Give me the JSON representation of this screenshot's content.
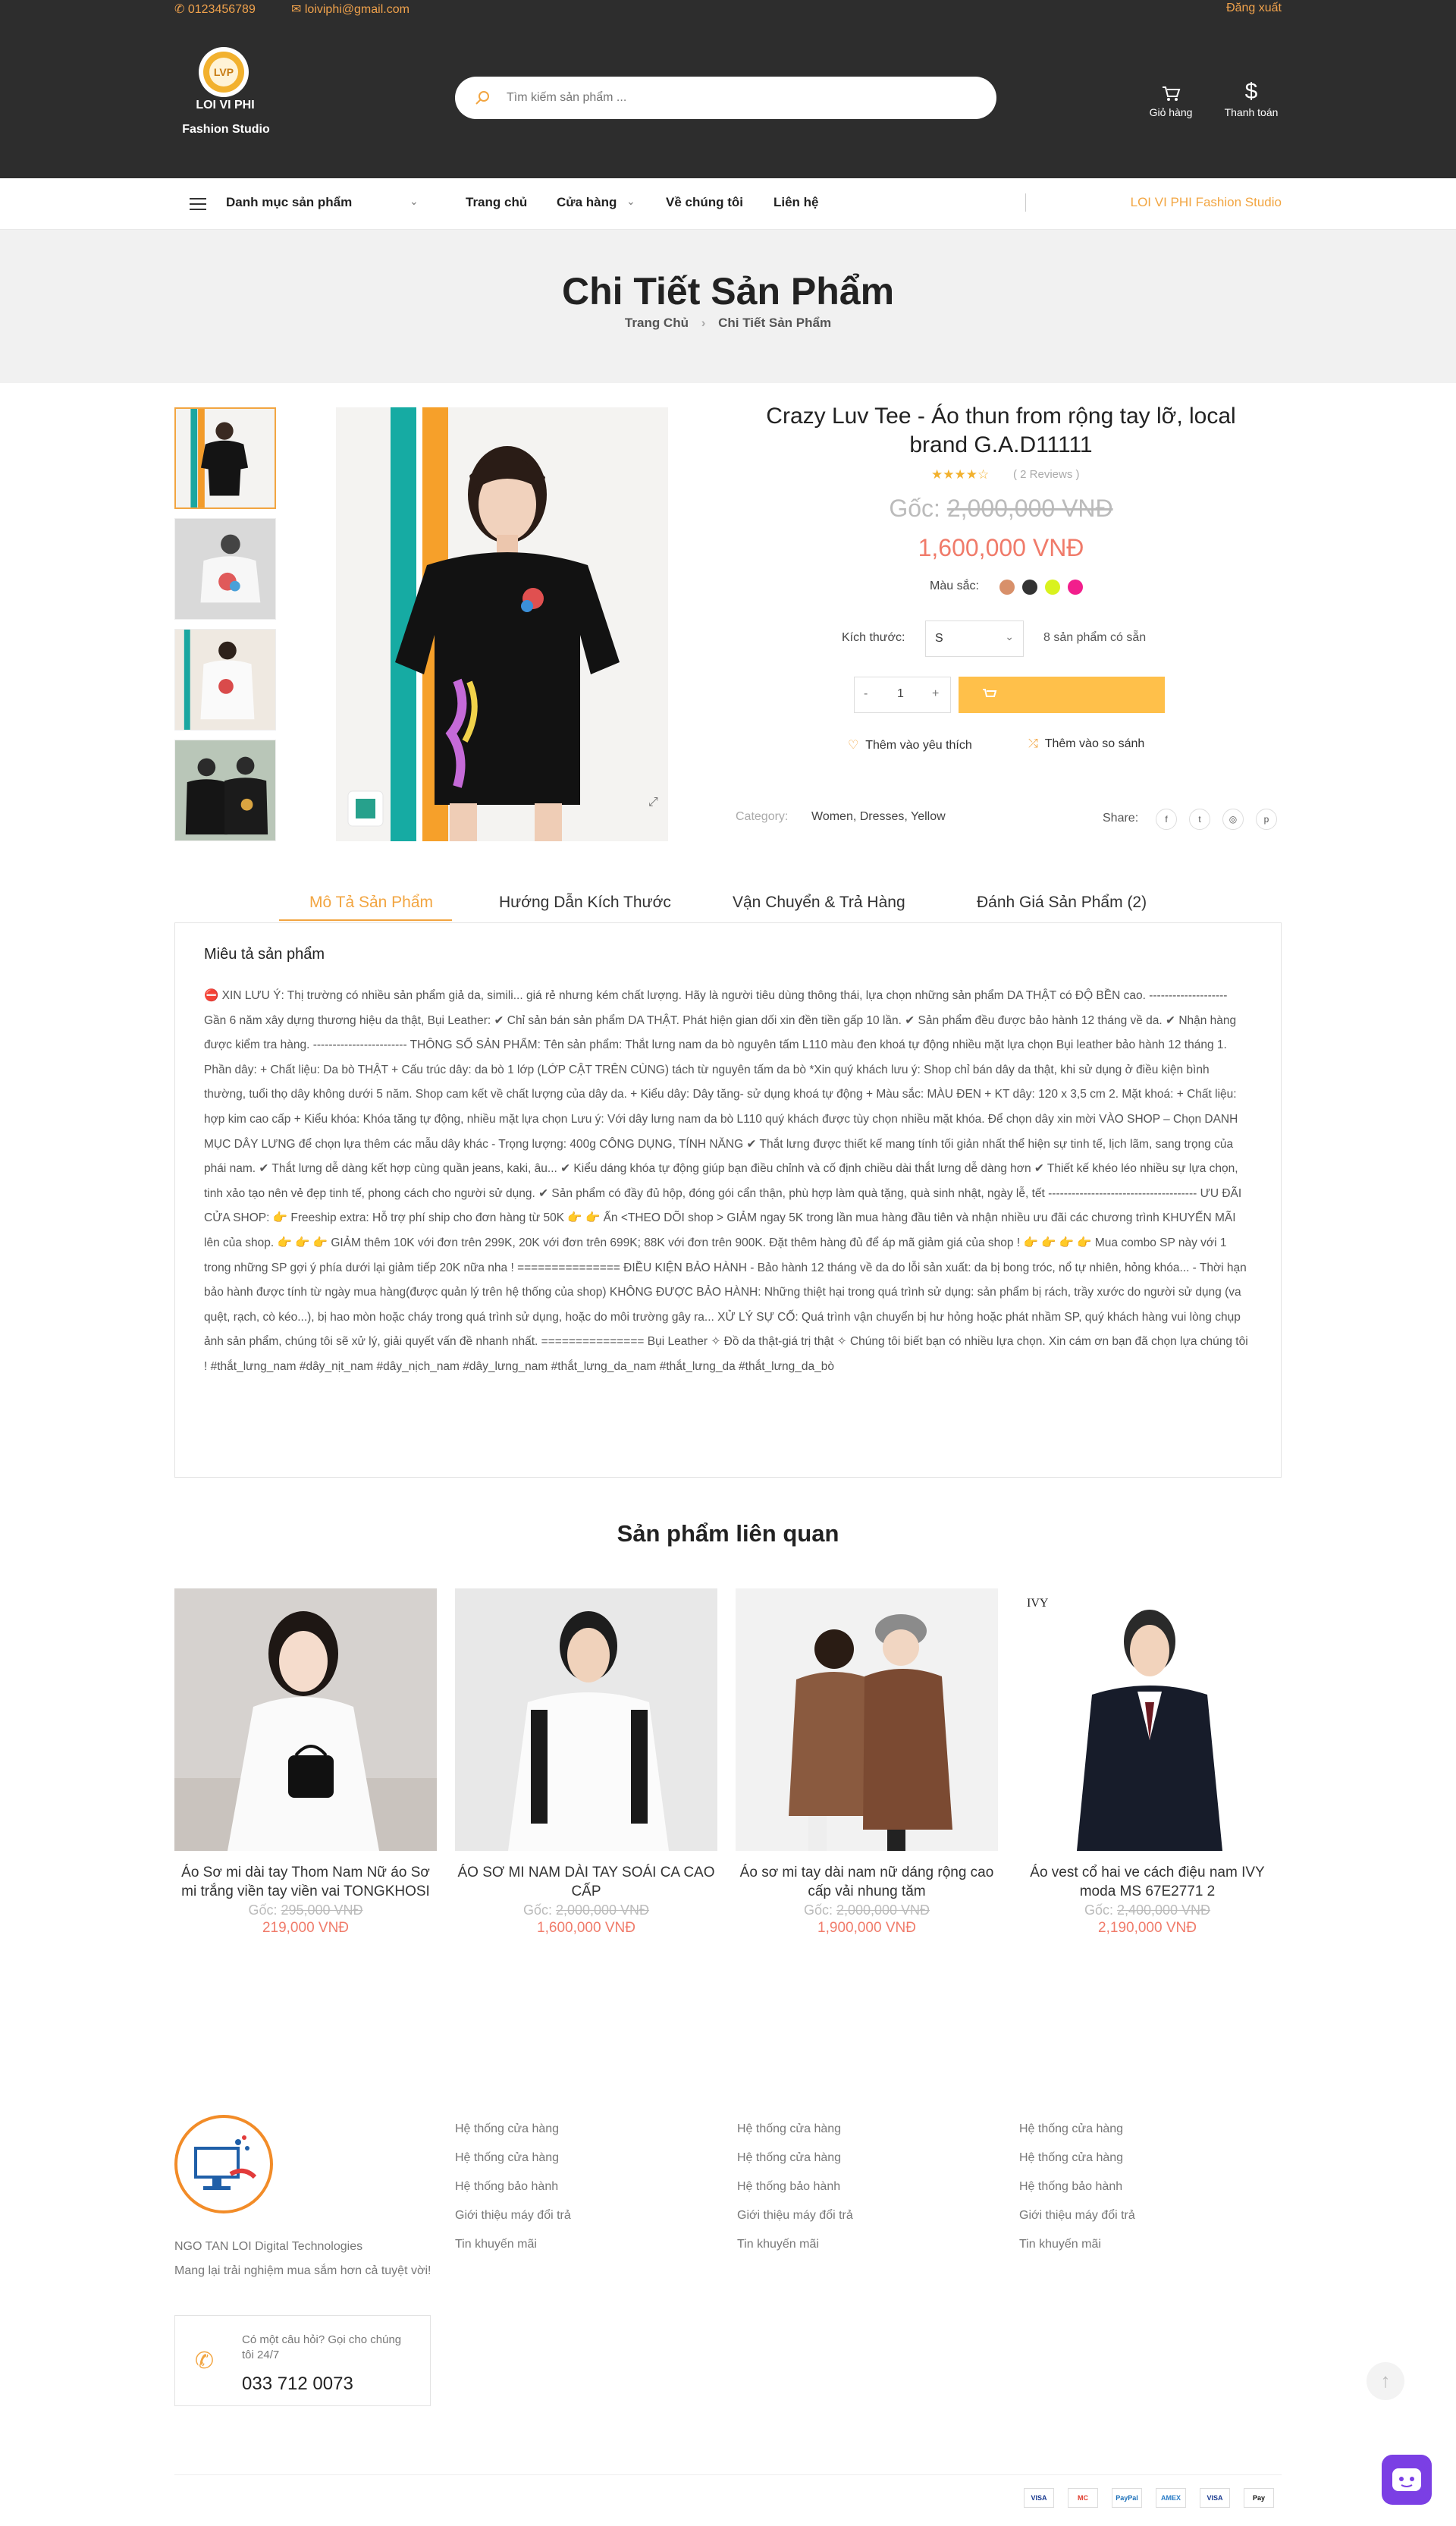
{
  "topbar": {
    "phone": "0123456789",
    "email": "loiviphi@gmail.com",
    "logout": "Đăng xuất"
  },
  "brand": {
    "line1": "LOI VI PHI",
    "line2": "Fashion Studio",
    "logo_mark": "LVP"
  },
  "search": {
    "placeholder": "Tìm kiếm sản phẩm ..."
  },
  "header_actions": {
    "cart": "Giỏ hàng",
    "checkout": "Thanh toán"
  },
  "nav": {
    "categories": "Danh mục sản phẩm",
    "home": "Trang chủ",
    "shop": "Cửa hàng",
    "about": "Về chúng tôi",
    "contact": "Liên hệ",
    "right_brand": "LOI VI PHI Fashion Studio"
  },
  "hero": {
    "title": "Chi Tiết Sản Phẩm",
    "crumb_home": "Trang Chủ",
    "crumb_sep": "›",
    "crumb_current": "Chi Tiết Sản Phẩm"
  },
  "product": {
    "title": "Crazy Luv Tee - Áo thun from rộng tay lỡ, local brand G.A.D11111",
    "stars": "★★★★☆",
    "reviews": "( 2 Reviews )",
    "old_label": "Gốc:",
    "old_price": "2,000,000 VNĐ",
    "price": "1,600,000 VNĐ",
    "color_label": "Màu sắc:",
    "colors": [
      "#d8906a",
      "#333333",
      "#d9f21e",
      "#f21e8c"
    ],
    "size_label": "Kích thước:",
    "size_value": "S",
    "stock": "8 sản phẩm có sẵn",
    "qty_minus": "-",
    "qty": "1",
    "qty_plus": "+",
    "wishlist": "Thêm vào yêu thích",
    "compare": "Thêm vào so sánh",
    "category_label": "Category:",
    "categories": "Women, Dresses, Yellow",
    "share_label": "Share:",
    "share_icons": [
      "f",
      "t",
      "◎",
      "p"
    ]
  },
  "tabs": [
    "Mô Tả Sản Phẩm",
    "Hướng Dẫn Kích Thước",
    "Vận Chuyển & Trả Hàng",
    "Đánh Giá Sản Phẩm (2)"
  ],
  "description": {
    "title": "Miêu tả sản phẩm",
    "text": "⛔ XIN LƯU Ý: Thị trường có nhiều sản phẩm giả da, simili... giá rẻ nhưng kém chất lượng. Hãy là người tiêu dùng thông thái, lựa chọn những sản phẩm DA THẬT có ĐỘ BỀN cao. -------------------- Gần 6 năm xây dựng thương hiệu da thật, Bụi Leather: ✔ Chỉ sản bán sản phẩm DA THẬT. Phát hiện gian dối xin đền tiền gấp 10 lần. ✔ Sản phẩm đều được bảo hành 12 tháng về da. ✔ Nhận hàng được kiểm tra hàng. ------------------------ THÔNG SỐ SẢN PHẨM: Tên sản phẩm: Thắt lưng nam da bò nguyên tấm L110 màu đen khoá tự động nhiều mặt lựa chọn Bụi leather bảo hành 12 tháng 1. Phần dây: + Chất liệu: Da bò THẬT + Cấu trúc dây: da bò 1 lớp (LỚP CẬT TRÊN CÙNG) tách từ nguyên tấm da bò *Xin quý khách lưu ý: Shop chỉ bán dây da thật, khi sử dụng ở điều kiện bình thường, tuổi thọ dây không dưới 5 năm. Shop cam kết về chất lượng của dây da. + Kiểu dây: Dây tăng- sử dụng khoá tự động + Màu sắc: MÀU ĐEN + KT dây: 120 x 3,5 cm 2. Mặt khoá: + Chất liệu: hợp kim cao cấp + Kiểu khóa: Khóa tăng tự động, nhiều mặt lựa chọn Lưu ý: Với dây lưng nam da bò L110 quý khách được tùy chọn nhiều mặt khóa. Để chọn dây xin mời VÀO SHOP – Chọn DANH MỤC DÂY LƯNG để chọn lựa thêm các mẫu dây khác - Trọng lượng: 400g CÔNG DỤNG, TÍNH NĂNG ✔ Thắt lưng được thiết kế mang tính tối giản nhất thể hiện sự tinh tế, lịch lãm, sang trọng của phái nam. ✔ Thắt lưng dễ dàng kết hợp cùng quần jeans, kaki, âu... ✔ Kiểu dáng khóa tự động giúp bạn điều chỉnh và cố định chiều dài thắt lưng dễ dàng hơn ✔ Thiết kế khéo léo nhiều sự lựa chọn, tinh xảo tạo nên vẻ đẹp tinh tế, phong cách cho người sử dụng. ✔ Sản phẩm có đầy đủ hộp, đóng gói cẩn thận, phù hợp làm quà tặng, quà sinh nhật, ngày lễ, tết -------------------------------------- ƯU ĐÃI CỬA SHOP: 👉 Freeship extra: Hỗ trợ phí ship cho đơn hàng từ 50K 👉 👉 Ấn <THEO DÕI shop > GIẢM ngay 5K trong lần mua hàng đầu tiên và nhận nhiều ưu đãi các chương trình KHUYẾN MÃI lên của shop. 👉 👉 👉 GIẢM thêm 10K với đơn trên 299K, 20K với đơn trên 699K; 88K với đơn trên 900K. Đặt thêm hàng đủ để áp mã giảm giá của shop ! 👉 👉 👉 👉 Mua combo SP này với 1 trong những SP gợi ý phía dưới lại giảm tiếp 20K nữa nha ! =============== ĐIỀU KIỆN BẢO HÀNH - Bảo hành 12 tháng về da do lỗi sản xuất: da bị bong tróc, nổ tự nhiên, hỏng khóa... - Thời hạn bảo hành được tính từ ngày mua hàng(được quản lý trên hệ thống của shop) KHÔNG ĐƯỢC BẢO HÀNH: Những thiệt hại trong quá trình sử dụng: sản phẩm bị rách, trầy xước do người sử dụng (va quệt, rạch, cò kéo...), bị hao mòn hoặc cháy trong quá trình sử dụng, hoặc do môi trường gây ra... XỬ LÝ SỰ CỐ: Quá trình vận chuyển bị hư hỏng hoặc phát nhầm SP, quý khách hàng vui lòng chụp ảnh sản phẩm, chúng tôi sẽ xử lý, giải quyết vấn đề nhanh nhất. =============== Bụi Leather ✧ Đồ da thật-giá trị thật ✧ Chúng tôi biết bạn có nhiều lựa chọn. Xin cám ơn bạn đã chọn lựa chúng tôi ! #thắt_lưng_nam #dây_nịt_nam #dây_nịch_nam #dây_lưng_nam #thắt_lưng_da_nam #thắt_lưng_da #thắt_lưng_da_bò"
  },
  "related": {
    "title": "Sản phẩm liên quan",
    "items": [
      {
        "name": "Áo Sơ mi dài tay Thom Nam Nữ áo Sơ mi trắng viền tay viền vai TONGKHOSI",
        "old_label": "Gốc:",
        "old": "295,000 VNĐ",
        "price": "219,000 VNĐ"
      },
      {
        "name": "ÁO SƠ MI NAM DÀI TAY SOÁI CA CAO CẤP",
        "old_label": "Gốc:",
        "old": "2,000,000 VNĐ",
        "price": "1,600,000 VNĐ"
      },
      {
        "name": "Áo sơ mi tay dài nam nữ dáng rộng cao cấp vải nhung tăm",
        "old_label": "Gốc:",
        "old": "2,000,000 VNĐ",
        "price": "1,900,000 VNĐ"
      },
      {
        "name": "Áo vest cổ hai ve cách điệu nam IVY moda MS 67E2771 2",
        "old_label": "Gốc:",
        "old": "2,400,000 VNĐ",
        "price": "2,190,000 VNĐ"
      }
    ]
  },
  "footer": {
    "company": "NGO TAN LOI Digital Technologies",
    "tagline": "Mang lại trải nghiệm mua sắm hơn cả tuyệt vời!",
    "contact_prompt": "Có một câu hỏi? Gọi cho chúng tôi 24/7",
    "phone": "033 712 0073",
    "col1": [
      "Hệ thống cửa hàng",
      "Hệ thống cửa hàng",
      "Hệ thống bảo hành",
      "Giới thiệu máy đổi trả",
      "Tin khuyến mãi"
    ],
    "col2": [
      "Hệ thống cửa hàng",
      "Hệ thống cửa hàng",
      "Hệ thống bảo hành",
      "Giới thiệu máy đổi trả",
      "Tin khuyến mãi"
    ],
    "col3": [
      "Hệ thống cửa hàng",
      "Hệ thống cửa hàng",
      "Hệ thống bảo hành",
      "Giới thiệu máy đổi trả",
      "Tin khuyến mãi"
    ],
    "payments": [
      "VISA",
      "MC",
      "PayPal",
      "AMEX",
      "VISA",
      "Pay"
    ]
  }
}
